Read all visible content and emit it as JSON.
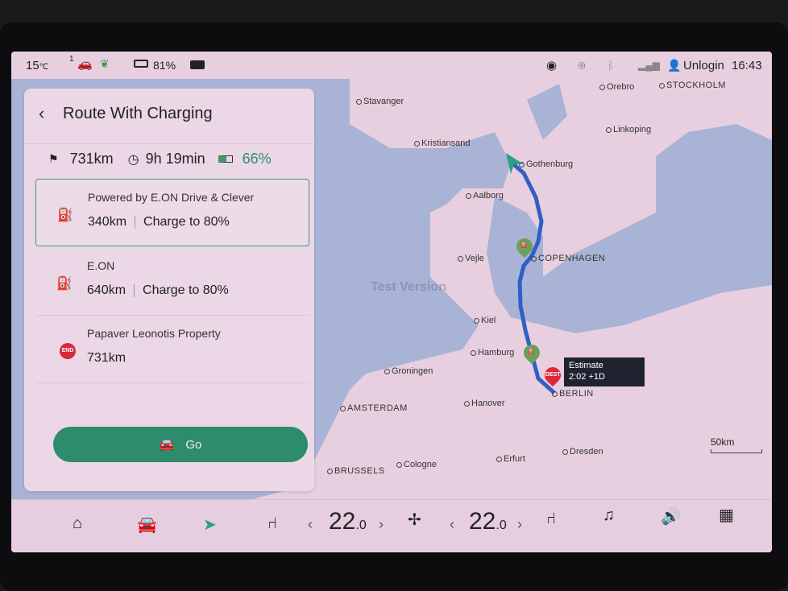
{
  "status": {
    "temperature": "15",
    "temp_unit": "℃",
    "gear": "1",
    "battery": "81%",
    "user": "Unlogin",
    "time": "16:43",
    "icons": [
      "car-charging-icon",
      "eco-leaf-icon",
      "battery-icon",
      "camera-icon",
      "hotspot-icon",
      "location-icon",
      "bluetooth-icon",
      "signal-icon",
      "user-icon"
    ]
  },
  "panel": {
    "title": "Route With Charging",
    "summary": {
      "distance": "731km",
      "duration": "9h 19min",
      "battery": "66%"
    },
    "stops": [
      {
        "name": "Powered by E.ON Drive & Clever",
        "distance": "340km",
        "charge": "Charge to 80%",
        "icon": "charging-station-icon",
        "selected": true
      },
      {
        "name": "E.ON",
        "distance": "640km",
        "charge": "Charge to 80%",
        "icon": "charging-station-icon"
      },
      {
        "name": "Papaver Leonotis Property",
        "distance": "731km",
        "badge": "END",
        "icon": "end-marker-icon"
      }
    ],
    "go_label": "Go"
  },
  "map": {
    "watermark": "Test Version",
    "scale": "50km",
    "estimate_label": "Estimate",
    "estimate_time": "2:02 +1D",
    "dest_badge": "DEST",
    "cities": [
      "Stavanger",
      "Orebro",
      "STOCKHOLM",
      "Linkoping",
      "Kristiansand",
      "Gothenburg",
      "Aalborg",
      "Vejle",
      "COPENHAGEN",
      "Kiel",
      "Hamburg",
      "Groningen",
      "BERLIN",
      "AMSTERDAM",
      "Hanover",
      "Dresden",
      "Erfurt",
      "Cologne",
      "BRUSSELS"
    ],
    "colors": {
      "land": "#e8cfe0",
      "sea": "#a9b3d6",
      "route": "#2f5fc4",
      "charger": "#6aa05a",
      "dest": "#e0283c"
    }
  },
  "climate": {
    "left_temp": "22",
    "right_temp": "22",
    "decimal": ".0",
    "degree": "°"
  },
  "colors": {
    "accent": "#2c8c6c"
  }
}
